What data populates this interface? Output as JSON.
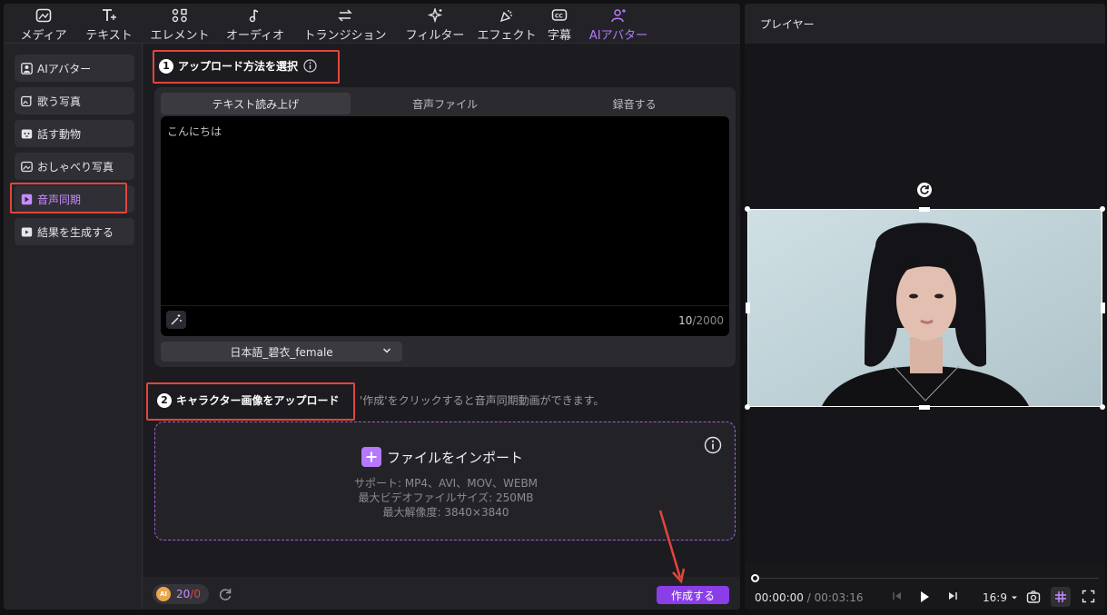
{
  "toolbar": {
    "items": [
      {
        "label": "メディア",
        "icon": "media-icon"
      },
      {
        "label": "テキスト",
        "icon": "text-icon"
      },
      {
        "label": "エレメント",
        "icon": "elements-icon"
      },
      {
        "label": "オーディオ",
        "icon": "audio-icon"
      },
      {
        "label": "トランジション",
        "icon": "transition-icon"
      },
      {
        "label": "フィルター",
        "icon": "filter-icon"
      },
      {
        "label": "エフェクト",
        "icon": "effect-icon"
      },
      {
        "label": "字幕",
        "icon": "subtitle-icon"
      },
      {
        "label": "AIアバター",
        "icon": "ai-avatar-icon",
        "active": true
      }
    ]
  },
  "sidebar": {
    "items": [
      {
        "label": "AIアバター"
      },
      {
        "label": "歌う写真"
      },
      {
        "label": "話す動物"
      },
      {
        "label": "おしゃべり写真"
      },
      {
        "label": "音声同期",
        "active": true
      },
      {
        "label": "結果を生成する"
      }
    ]
  },
  "step1": {
    "num": "1",
    "title": "アップロード方法を選択"
  },
  "tabs": {
    "tts": "テキスト読み上げ",
    "audio_file": "音声ファイル",
    "record": "録音する"
  },
  "text_input": {
    "value": "こんにちは",
    "count": "10",
    "max": "/2000"
  },
  "voice": {
    "selected": "日本語_碧衣_female"
  },
  "step2": {
    "num": "2",
    "title": "キャラクター画像をアップロード"
  },
  "hint": "'作成'をクリックすると音声同期動画ができます。",
  "upload": {
    "label": "ファイルをインポート",
    "support": "サポート: MP4、AVI、MOV、WEBM",
    "max_size": "最大ビデオファイルサイズ: 250MB",
    "max_resolution": "最大解像度: 3840×3840"
  },
  "credits": {
    "current": "20",
    "slash": "/",
    "used": "0",
    "coin": "AI"
  },
  "create_button": "作成する",
  "player": {
    "title": "プレイヤー",
    "time_current": "00:00:00",
    "time_sep": " / ",
    "time_total": "00:03:16",
    "ratio": "16:9"
  },
  "colors": {
    "accent": "#b678ff",
    "button": "#8a3ee8",
    "highlight_box": "#e2453d"
  }
}
